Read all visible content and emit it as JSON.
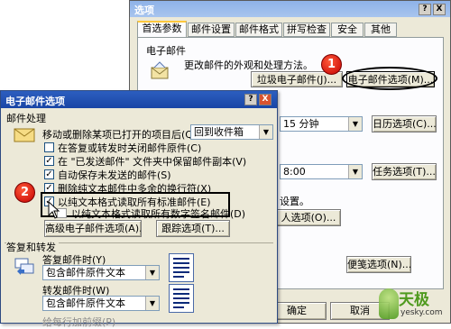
{
  "back_dialog": {
    "title": "选项",
    "title_buttons": [
      "?",
      "X"
    ],
    "tabs": [
      "首选参数",
      "邮件设置",
      "邮件格式",
      "拼写检查",
      "安全",
      "其他"
    ],
    "section_email": "电子邮件",
    "email_desc": "更改邮件的外观和处理方法。",
    "junk_button": "垃圾电子邮件(J)...",
    "email_options_button": "电子邮件选项(M)...",
    "reminder_value": "15 分钟",
    "calendar_button": "日历选项(C)...",
    "time_value": "8:00",
    "task_button": "任务选项(T)...",
    "settings_text": "设置。",
    "contacts_button": "人选项(O)...",
    "notes_button": "便笺选项(N)...",
    "ok_button": "确定",
    "cancel_button": "取消"
  },
  "front_dialog": {
    "title": "电子邮件选项",
    "title_buttons": [
      "?",
      "X"
    ],
    "section_handling": "邮件处理",
    "after_move_label": "移动或删除某项已打开的项目后(Q):",
    "after_move_value": "回到收件箱",
    "checks": [
      {
        "label": "在答复或转发时关闭邮件原件(C)",
        "checked": false
      },
      {
        "label": "在 \"已发送邮件\" 文件夹中保留邮件副本(V)",
        "checked": true
      },
      {
        "label": "自动保存未发送的邮件(S)",
        "checked": true
      },
      {
        "label": "删除纯文本邮件中多余的换行符(X)",
        "checked": true
      },
      {
        "label": "以纯文本格式读取所有标准邮件(E)",
        "checked": true
      },
      {
        "label": "以纯文本格式读取所有数字签名邮件(D)",
        "checked": false
      }
    ],
    "advanced_button": "高级电子邮件选项(A)...",
    "tracking_button": "跟踪选项(T)...",
    "section_reply": "答复和转发",
    "reply_label": "答复邮件时(Y)",
    "reply_value": "包含邮件原件文本",
    "forward_label": "转发邮件时(W)",
    "forward_value": "包含邮件原件文本",
    "prefix_label": "给每行加前缀(P)"
  },
  "callouts": [
    "1",
    "2"
  ],
  "watermark": {
    "brand": "天极",
    "site": "yesky.com"
  }
}
